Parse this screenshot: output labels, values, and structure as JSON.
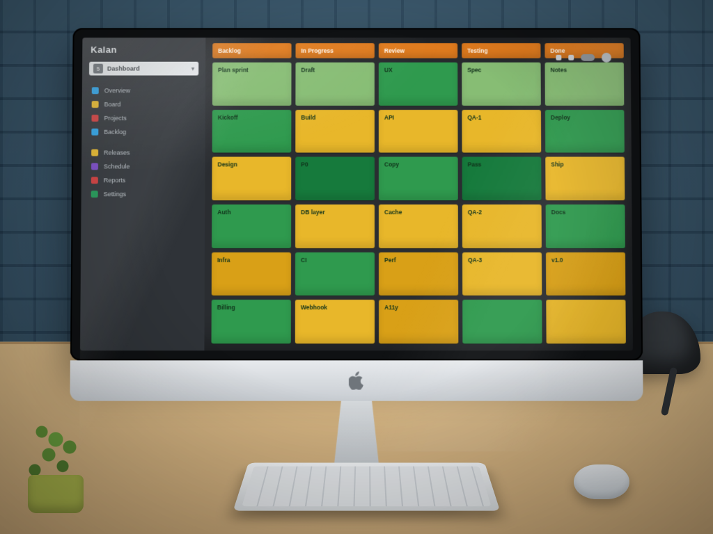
{
  "app": {
    "brand": "Kalan"
  },
  "search": {
    "badge": "5",
    "label": "Dashboard",
    "chevron": "▾"
  },
  "sidebar": {
    "groups": [
      [
        {
          "color": "#2aa3e8",
          "label": "Overview"
        },
        {
          "color": "#e8b92a",
          "label": "Board"
        },
        {
          "color": "#d23c3c",
          "label": "Projects"
        },
        {
          "color": "#2aa3e8",
          "label": "Backlog"
        }
      ],
      [
        {
          "color": "#e8b92a",
          "label": "Releases",
          "icon": "calendar"
        },
        {
          "color": "#7a49c9",
          "label": "Schedule"
        },
        {
          "color": "#d23c3c",
          "label": "Reports"
        },
        {
          "color": "#1f9a55",
          "label": "Settings"
        }
      ]
    ]
  },
  "toolbar": {
    "items": [
      "filter-icon",
      "sort-icon",
      "view-toggle",
      "avatar"
    ]
  },
  "board": {
    "columns": [
      {
        "label": "Backlog"
      },
      {
        "label": "In Progress"
      },
      {
        "label": "Review"
      },
      {
        "label": "Testing"
      },
      {
        "label": "Done"
      }
    ],
    "palette": {
      "lightgreen": "#8fc87a",
      "green": "#2f9a4e",
      "darkgreen": "#167a3c",
      "yellow": "#e8b72a",
      "gold": "#d9a017",
      "orange": "#e0861e"
    },
    "rows": [
      [
        {
          "c": "lightgreen",
          "t": "Plan sprint"
        },
        {
          "c": "lightgreen",
          "t": "Draft"
        },
        {
          "c": "green",
          "t": "UX"
        },
        {
          "c": "lightgreen",
          "t": "Spec"
        },
        {
          "c": "lightgreen",
          "t": "Notes"
        }
      ],
      [
        {
          "c": "green",
          "t": "Kickoff"
        },
        {
          "c": "yellow",
          "t": "Build"
        },
        {
          "c": "yellow",
          "t": "API"
        },
        {
          "c": "yellow",
          "t": "QA-1"
        },
        {
          "c": "green",
          "t": "Deploy"
        }
      ],
      [
        {
          "c": "yellow",
          "t": "Design"
        },
        {
          "c": "darkgreen",
          "t": "P0"
        },
        {
          "c": "green",
          "t": "Copy"
        },
        {
          "c": "darkgreen",
          "t": "Pass"
        },
        {
          "c": "yellow",
          "t": "Ship"
        }
      ],
      [
        {
          "c": "green",
          "t": "Auth"
        },
        {
          "c": "yellow",
          "t": "DB layer"
        },
        {
          "c": "yellow",
          "t": "Cache"
        },
        {
          "c": "yellow",
          "t": "QA-2"
        },
        {
          "c": "green",
          "t": "Docs"
        }
      ],
      [
        {
          "c": "gold",
          "t": "Infra"
        },
        {
          "c": "green",
          "t": "CI"
        },
        {
          "c": "gold",
          "t": "Perf"
        },
        {
          "c": "yellow",
          "t": "QA-3"
        },
        {
          "c": "gold",
          "t": "v1.0"
        }
      ],
      [
        {
          "c": "green",
          "t": "Billing"
        },
        {
          "c": "yellow",
          "t": "Webhook"
        },
        {
          "c": "gold",
          "t": "A11y"
        },
        {
          "c": "green",
          "t": ""
        },
        {
          "c": "yellow",
          "t": ""
        }
      ]
    ]
  }
}
